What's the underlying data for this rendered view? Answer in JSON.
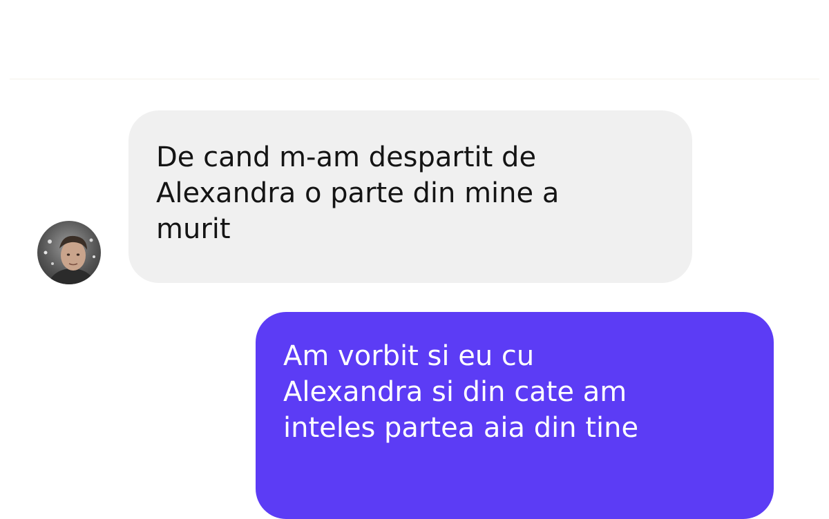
{
  "conversation": {
    "messages": [
      {
        "direction": "incoming",
        "text": "De cand m-am despartit de\nAlexandra o parte din mine a\nmurit"
      },
      {
        "direction": "outgoing",
        "text": "Am vorbit si eu cu\nAlexandra si din cate am\ninteles partea aia din tine"
      }
    ],
    "contact": {
      "avatar_icon": "contact-avatar-photo"
    }
  },
  "colors": {
    "incoming_bubble": "#f0f0f0",
    "outgoing_bubble": "#5c3cf5",
    "background": "#ffffff"
  }
}
